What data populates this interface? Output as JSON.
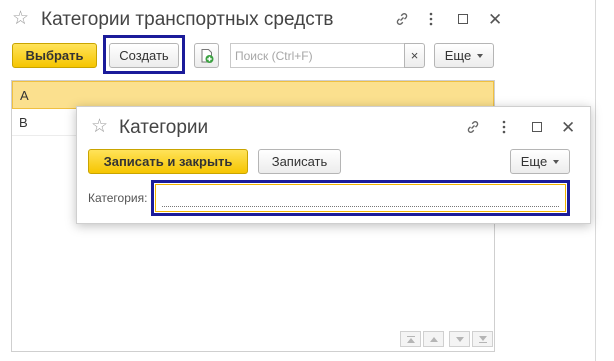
{
  "main_window": {
    "title": "Категории транспортных средств",
    "toolbar": {
      "select_label": "Выбрать",
      "create_label": "Создать",
      "search_placeholder": "Поиск (Ctrl+F)",
      "search_clear": "×",
      "more_label": "Еще"
    },
    "list": {
      "rows": [
        {
          "label": "A",
          "selected": true
        },
        {
          "label": "B",
          "selected": false
        }
      ]
    }
  },
  "dialog": {
    "title": "Категории",
    "toolbar": {
      "save_close_label": "Записать и закрыть",
      "save_label": "Записать",
      "more_label": "Еще"
    },
    "field_label": "Категория:",
    "field_value": ""
  },
  "colors": {
    "accent_yellow": "#f6c500",
    "selected_row": "#fbe08e",
    "highlight_frame": "#1b1b9a"
  },
  "icons": {
    "favorite": "star-icon",
    "link": "link-icon",
    "more": "more-vertical-icon",
    "maximize": "maximize-icon",
    "close": "close-icon",
    "new_document": "new-document-icon"
  }
}
